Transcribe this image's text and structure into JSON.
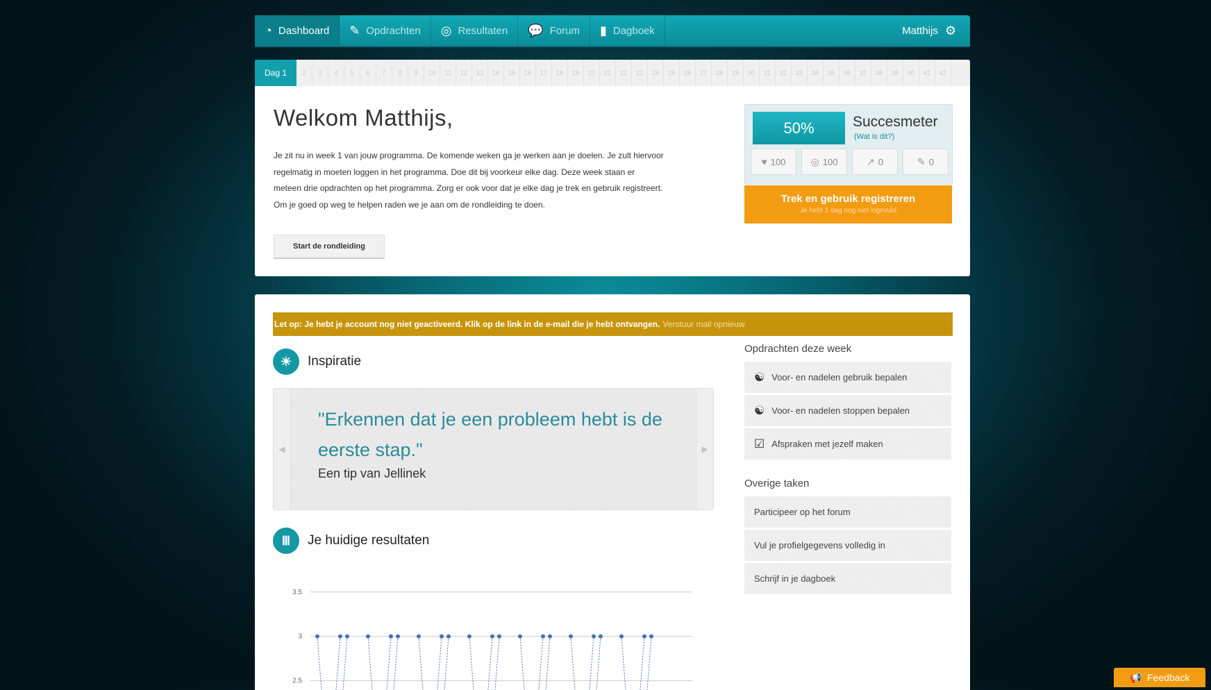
{
  "nav": {
    "items": [
      {
        "label": "Dashboard",
        "icon": "dashboard-icon",
        "glyph": "◔"
      },
      {
        "label": "Opdrachten",
        "icon": "pencil-icon",
        "glyph": "✎"
      },
      {
        "label": "Resultaten",
        "icon": "target-icon",
        "glyph": "◎"
      },
      {
        "label": "Forum",
        "icon": "chat-icon",
        "glyph": "💬"
      },
      {
        "label": "Dagboek",
        "icon": "book-icon",
        "glyph": "▮"
      }
    ],
    "user": "Matthijs",
    "settings_glyph": "⚙"
  },
  "days": {
    "current_label": "Dag 1",
    "others": [
      "2",
      "3",
      "4",
      "5",
      "6",
      "7",
      "8",
      "9",
      "10",
      "11",
      "12",
      "13",
      "14",
      "15",
      "16",
      "17",
      "18",
      "19",
      "20",
      "21",
      "22",
      "23",
      "24",
      "25",
      "26",
      "27",
      "28",
      "29",
      "30",
      "31",
      "32",
      "33",
      "34",
      "35",
      "36",
      "37",
      "38",
      "39",
      "40",
      "41",
      "42"
    ]
  },
  "welcome": {
    "title": "Welkom Matthijs,",
    "lines": [
      "Je zit nu in week 1 van jouw programma. De komende weken ga je werken aan je doelen. Je zult hiervoor",
      "regelmatig in moeten loggen in het programma. Doe dit bij voorkeur elke dag. Deze week staan er",
      "meteen drie opdrachten op het programma. Zorg er ook voor dat je elke dag je trek en gebruik registreert.",
      "Om je goed op weg te helpen raden we je aan om de rondleiding te doen."
    ],
    "tour_button": "Start de rondleiding"
  },
  "succesmeter": {
    "percent": "50%",
    "title": "Succesmeter",
    "link": "(Wat is dit?)",
    "stats": [
      {
        "icon": "heart-icon",
        "glyph": "♥",
        "value": "100"
      },
      {
        "icon": "target-icon",
        "glyph": "◎",
        "value": "100"
      },
      {
        "icon": "trend-icon",
        "glyph": "↗",
        "value": "0"
      },
      {
        "icon": "pencil-icon",
        "glyph": "✎",
        "value": "0"
      }
    ]
  },
  "trek": {
    "title": "Trek en gebruik registreren",
    "subtitle": "Je hebt 1 dag nog niet ingevuld"
  },
  "warning": {
    "text": "Let op: Je hebt je account nog niet geactiveerd. Klik op de link in de e-mail die je hebt ontvangen.",
    "resend": "Verstuur mail opnieuw"
  },
  "inspiratie": {
    "title": "Inspiratie",
    "quote": "\"Erkennen dat je een probleem hebt is de eerste stap.\"",
    "source": "Een tip van Jellinek"
  },
  "resultaten": {
    "title": "Je huidige resultaten"
  },
  "opdrachten": {
    "title": "Opdrachten deze week",
    "items": [
      {
        "label": "Voor- en nadelen gebruik bepalen",
        "icon": "yin-yang-icon",
        "glyph": "☯"
      },
      {
        "label": "Voor- en nadelen stoppen bepalen",
        "icon": "yin-yang-icon",
        "glyph": "☯"
      },
      {
        "label": "Afspraken met jezelf maken",
        "icon": "checkbox-icon",
        "glyph": "☑"
      }
    ]
  },
  "overige": {
    "title": "Overige taken",
    "items": [
      {
        "label": "Participeer op het forum"
      },
      {
        "label": "Vul je profielgegevens volledig in"
      },
      {
        "label": "Schrijf in je dagboek"
      }
    ]
  },
  "feedback": {
    "label": "Feedback",
    "icon": "megaphone-icon",
    "glyph": "📢"
  },
  "chart_data": {
    "type": "line",
    "y_ticks": [
      "3.5",
      "3",
      "2.5"
    ],
    "ylim": [
      2.2,
      3.6
    ],
    "series_color": "#4a6fb5",
    "points_y": [
      3,
      3,
      3,
      3,
      3,
      3,
      3,
      3,
      3,
      3,
      3,
      3,
      3,
      3,
      3,
      3,
      3,
      3,
      3,
      3,
      3
    ],
    "grid": true
  }
}
